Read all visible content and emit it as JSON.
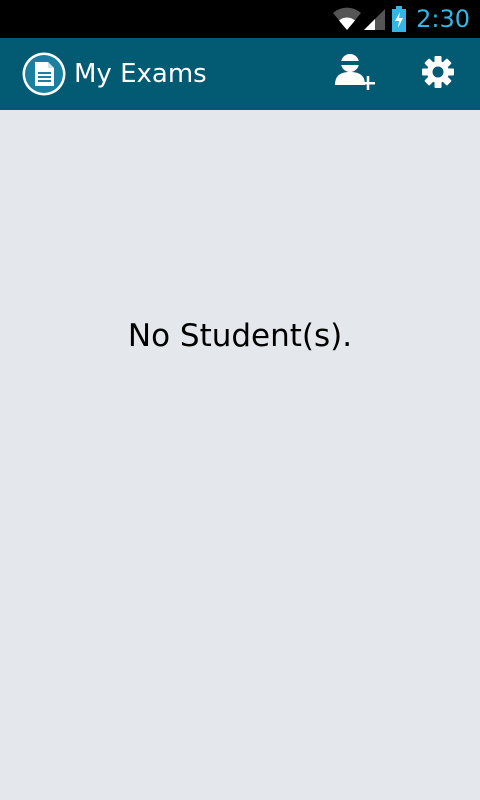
{
  "status_bar": {
    "time": "2:30",
    "icons": [
      "wifi-icon",
      "signal-icon",
      "battery-charging-icon"
    ],
    "accent_color": "#33b5e5"
  },
  "action_bar": {
    "title": "My Exams",
    "app_icon": "document-icon",
    "actions": [
      "add-student-icon",
      "gear-icon"
    ],
    "background_color": "#035a73"
  },
  "main": {
    "empty_message": "No Student(s).",
    "background_color": "#e4e8ec"
  }
}
